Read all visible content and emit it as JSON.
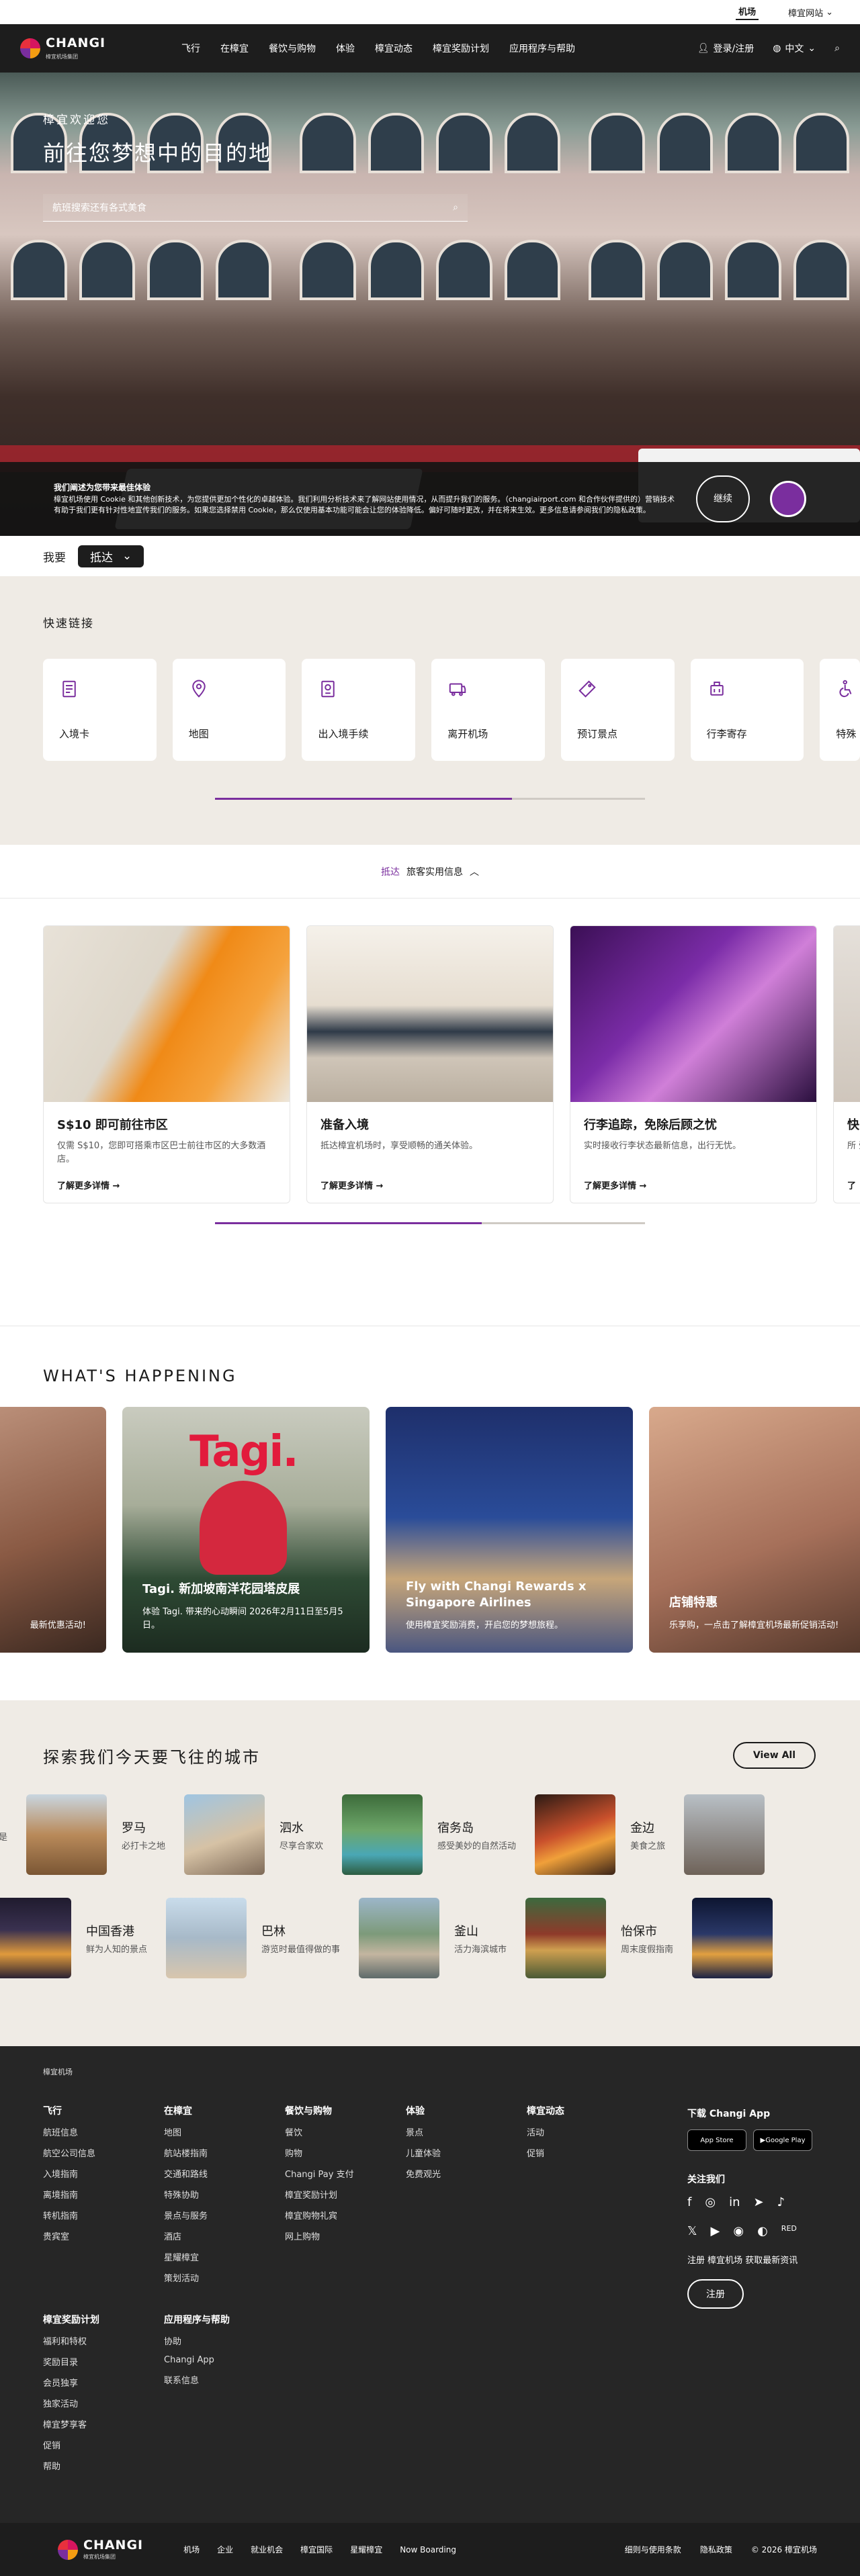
{
  "utility": {
    "airport": "机场",
    "corporate": "樟宜网站"
  },
  "nav": {
    "logo_main": "CHANGI",
    "logo_sub": "樟宜机场集团",
    "menu": [
      "飞行",
      "在樟宜",
      "餐饮与购物",
      "体验",
      "樟宜动态",
      "樟宜奖励计划",
      "应用程序与帮助"
    ],
    "login": "登录/注册",
    "lang": "中文"
  },
  "hero": {
    "eyebrow": "樟宜欢迎您",
    "title": "前往您梦想中的目的地",
    "search_placeholder": "航班搜索还有各式美食"
  },
  "cookie": {
    "title": "我们阐述为您带来最佳体验",
    "text": "樟宜机场使用 Cookie 和其他创新技术，为您提供更加个性化的卓越体验。我们利用分析技术来了解网站使用情况，从而提升我们的服务。（changiairport.com 和合作伙伴提供的）营销技术有助于我们更有针对性地宣传我们的服务。如果您选择禁用 Cookie，那么仅使用基本功能可能会让您的体验降低。偏好可随时更改，并在将来生效。更多信息请参阅我们的隐私政策。",
    "button": "继续"
  },
  "intent": {
    "label": "我要",
    "value": "抵达"
  },
  "quick": {
    "title": "快速链接",
    "items": [
      "入境卡",
      "地图",
      "出入境手续",
      "离开机场",
      "预订景点",
      "行李寄存",
      "特殊"
    ],
    "progress": 0.69
  },
  "tips": {
    "lead": "抵达",
    "text": "旅客实用信息"
  },
  "info": {
    "cards": [
      {
        "title": "S$10 即可前往市区",
        "desc": "仅需 S$10，您即可搭乘市区巴士前往市区的大多数酒店。",
        "more": "了解更多详情"
      },
      {
        "title": "准备入境",
        "desc": "抵达樟宜机场时，享受顺畅的通关体验。",
        "more": "了解更多详情"
      },
      {
        "title": "行李追踪，免除后顾之忧",
        "desc": "实时接收行李状态最新信息，出行无忧。",
        "more": "了解更多详情"
      },
      {
        "title": "快",
        "desc": "所 受",
        "more": "了"
      }
    ],
    "progress": 0.62
  },
  "happen": {
    "title": "WHAT'S HAPPENING",
    "cards": [
      {
        "title": "",
        "desc": "最新优惠活动!"
      },
      {
        "title": "Tagi. 新加坡南洋花园塔皮展",
        "desc": "体验 Tagi. 带来的心动瞬间 2026年2月11日至5月5日。"
      },
      {
        "title": "Fly with Changi Rewards x Singapore Airlines",
        "desc": "使用樟宜奖励消费，开启您的梦想旅程。"
      },
      {
        "title": "店铺特惠",
        "desc": "乐享购，一点击了解樟宜机场最新促销活动!"
      }
    ],
    "tagi_word": "Tagi."
  },
  "explore": {
    "title": "探索我们今天要飞往的城市",
    "view_all": "View All",
    "row1": [
      {
        "name": "",
        "sub": "去畅饮比比皆是"
      },
      {
        "name": "罗马",
        "sub": "必打卡之地"
      },
      {
        "name": "泗水",
        "sub": "尽享合家欢"
      },
      {
        "name": "宿务岛",
        "sub": "感受美妙的自然活动"
      },
      {
        "name": "金边",
        "sub": "美食之旅"
      }
    ],
    "row2": [
      {
        "name": "中国香港",
        "sub": "鲜为人知的景点"
      },
      {
        "name": "巴林",
        "sub": "游览时最值得做的事"
      },
      {
        "name": "釜山",
        "sub": "活力海滨城市"
      },
      {
        "name": "怡保市",
        "sub": "周末度假指南"
      },
      {
        "name": "",
        "sub": ""
      }
    ]
  },
  "footer": {
    "brand": "樟宜机场",
    "cols": [
      {
        "title": "飞行",
        "links": [
          "航班信息",
          "航空公司信息",
          "入境指南",
          "离境指南",
          "转机指南",
          "贵宾室"
        ]
      },
      {
        "title": "在樟宜",
        "links": [
          "地图",
          "航站楼指南",
          "交通和路线",
          "特殊协助",
          "景点与服务",
          "酒店",
          "星耀樟宜",
          "策划活动"
        ]
      },
      {
        "title": "餐饮与购物",
        "links": [
          "餐饮",
          "购物",
          "Changi Pay 支付",
          "樟宜奖励计划",
          "樟宜购物礼宾",
          "网上购物"
        ]
      },
      {
        "title": "体验",
        "links": [
          "景点",
          "儿童体验",
          "免费观光"
        ]
      },
      {
        "title": "樟宜动态",
        "links": [
          "活动",
          "促销"
        ]
      }
    ],
    "cols2": [
      {
        "title": "樟宜奖励计划",
        "links": [
          "福利和特权",
          "奖励目录",
          "会员独享",
          "独家活动",
          "樟宜梦享客",
          "促销",
          "帮助"
        ]
      },
      {
        "title": "应用程序与帮助",
        "links": [
          "协助",
          "Changi App",
          "联系信息"
        ]
      }
    ],
    "app_title": "下载 Changi App",
    "app_store": "App Store",
    "google_play": "Google Play",
    "follow": "关注我们",
    "newsletter": "注册 樟宜机场 获取最新资讯",
    "register": "注册"
  },
  "bottom": {
    "links": [
      "机场",
      "企业",
      "就业机会",
      "樟宜国际",
      "星耀樟宜",
      "Now Boarding"
    ],
    "terms": "细则与使用条款",
    "privacy": "隐私政策",
    "copyright": "© 2026 樟宜机场"
  },
  "colors": {
    "accent": "#7a2e9e",
    "dark": "#1d1d1d",
    "sand": "#efebe5"
  }
}
